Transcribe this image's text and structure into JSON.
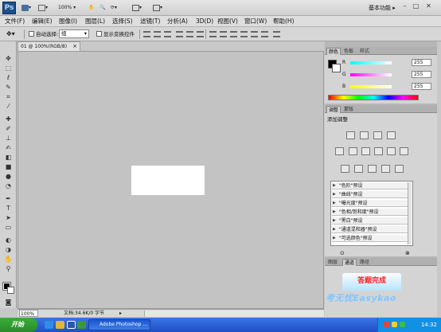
{
  "app": {
    "logo": "Ps",
    "zoom": "100%",
    "workspace": "基本功能",
    "window_controls": [
      "minimize",
      "restore",
      "close"
    ]
  },
  "menu": [
    "文件(F)",
    "编辑(E)",
    "图像(I)",
    "图层(L)",
    "选择(S)",
    "滤镜(T)",
    "分析(A)",
    "3D(D)",
    "视图(V)",
    "窗口(W)",
    "帮助(H)"
  ],
  "options": {
    "auto_select_label": "自动选择:",
    "auto_select_value": "组",
    "show_transform_label": "显示变换控件"
  },
  "document": {
    "tab_title": "01 @ 100%(RGB/8)"
  },
  "status": {
    "zoom": "100%",
    "doc_info": "文档:34.6K/0 字节"
  },
  "color_panel": {
    "tabs": [
      "颜色",
      "色板",
      "样式"
    ],
    "foreground": "#000000",
    "background": "#ffffff",
    "sliders": [
      {
        "label": "R",
        "value": "255",
        "gradient": "linear-gradient(to right,#00ffff,#ffffff)"
      },
      {
        "label": "G",
        "value": "255",
        "gradient": "linear-gradient(to right,#ff00ff,#ffffff)"
      },
      {
        "label": "B",
        "value": "255",
        "gradient": "linear-gradient(to right,#ffff00,#ffffff)"
      }
    ]
  },
  "adjustments_panel": {
    "tabs": [
      "调整",
      "蒙版"
    ],
    "title": "添加调整",
    "presets": [
      "\"色阶\"预设",
      "\"曲线\"预设",
      "\"曝光度\"预设",
      "\"色相/饱和度\"预设",
      "\"黑白\"预设",
      "\"通道混和器\"预设",
      "\"可选颜色\"预设"
    ]
  },
  "layers_panel": {
    "tabs": [
      "图层",
      "通道",
      "路径"
    ],
    "done_button": "答题完成",
    "watermark": "考无忧Easykao"
  },
  "taskbar": {
    "start": "开始",
    "task_label": "Adobe Photoshop ...",
    "time": "14:32"
  }
}
